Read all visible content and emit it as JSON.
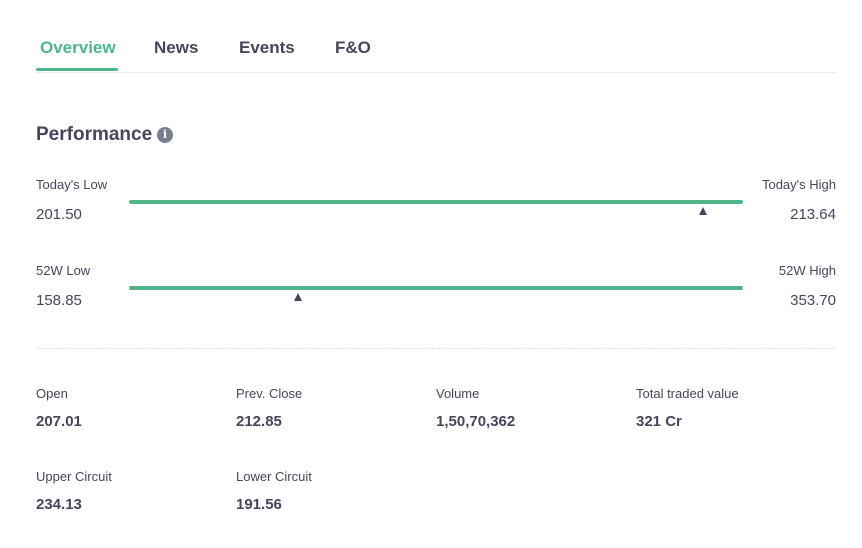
{
  "tabs": [
    {
      "label": "Overview",
      "active": true
    },
    {
      "label": "News",
      "active": false
    },
    {
      "label": "Events",
      "active": false
    },
    {
      "label": "F&O",
      "active": false
    }
  ],
  "performance": {
    "title": "Performance",
    "info_icon": "info-icon",
    "today": {
      "low_label": "Today's Low",
      "low_value": "201.50",
      "high_label": "Today's High",
      "high_value": "213.64",
      "marker_fraction": 0.935
    },
    "week52": {
      "low_label": "52W Low",
      "low_value": "158.85",
      "high_label": "52W High",
      "high_value": "353.70",
      "marker_fraction": 0.276
    }
  },
  "stats": {
    "open": {
      "label": "Open",
      "value": "207.01"
    },
    "prev_close": {
      "label": "Prev. Close",
      "value": "212.85"
    },
    "volume": {
      "label": "Volume",
      "value": "1,50,70,362"
    },
    "total_traded_value": {
      "label": "Total traded value",
      "value": "321 Cr"
    },
    "upper_circuit": {
      "label": "Upper Circuit",
      "value": "234.13"
    },
    "lower_circuit": {
      "label": "Lower Circuit",
      "value": "191.56"
    }
  },
  "colors": {
    "accent": "#4fb58a",
    "text": "#44475b",
    "marker": "#44475b"
  }
}
